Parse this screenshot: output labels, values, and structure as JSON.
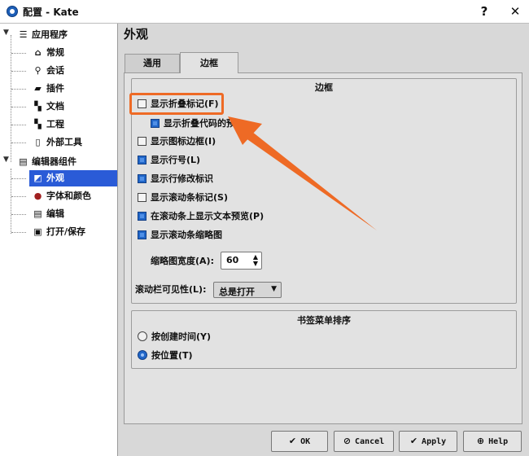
{
  "window": {
    "title": "配置 - Kate",
    "help_symbol": "?",
    "close_symbol": "✕"
  },
  "sidebar": {
    "app_group": {
      "label": "应用程序",
      "icon": "menu-lines-icon"
    },
    "app_items": [
      {
        "label": "常规",
        "icon": "home-icon"
      },
      {
        "label": "会话",
        "icon": "search-icon"
      },
      {
        "label": "插件",
        "icon": "plugin-icon"
      },
      {
        "label": "文档",
        "icon": "document-icon"
      },
      {
        "label": "工程",
        "icon": "project-icon"
      },
      {
        "label": "外部工具",
        "icon": "external-tools-icon"
      }
    ],
    "editor_group": {
      "label": "编辑器组件",
      "icon": "editor-component-icon"
    },
    "editor_items": [
      {
        "label": "外观",
        "icon": "appearance-icon"
      },
      {
        "label": "字体和颜色",
        "icon": "color-icon"
      },
      {
        "label": "编辑",
        "icon": "edit-icon"
      },
      {
        "label": "打开/保存",
        "icon": "save-icon"
      }
    ]
  },
  "page": {
    "heading": "外观",
    "tabs": [
      "通用",
      "边框"
    ],
    "borders_group": {
      "title": "边框",
      "options": [
        {
          "label": "显示折叠标记(F)",
          "checked": false
        },
        {
          "label": "显示折叠代码的预",
          "checked": true
        },
        {
          "label": "显示图标边框(I)",
          "checked": false
        },
        {
          "label": "显示行号(L)",
          "checked": true
        },
        {
          "label": "显示行修改标识",
          "checked": true
        },
        {
          "label": "显示滚动条标记(S)",
          "checked": false
        },
        {
          "label": "在滚动条上显示文本预览(P)",
          "checked": true
        },
        {
          "label": "显示滚动条缩略图",
          "checked": true
        }
      ],
      "minimap_width_label": "缩略图宽度(A):",
      "minimap_width_value": "60",
      "scrollbar_visibility_label": "滚动栏可见性(L):",
      "scrollbar_visibility_value": "总是打开"
    },
    "bookmarks_group": {
      "title": "书签菜单排序",
      "options": [
        {
          "label": "按创建时间(Y)",
          "checked": false
        },
        {
          "label": "按位置(T)",
          "checked": true
        }
      ]
    }
  },
  "buttons": {
    "ok": "OK",
    "cancel": "Cancel",
    "apply": "Apply",
    "help": "Help"
  },
  "colors": {
    "accent": "#2a5bd7",
    "highlight": "#ee6a25"
  }
}
